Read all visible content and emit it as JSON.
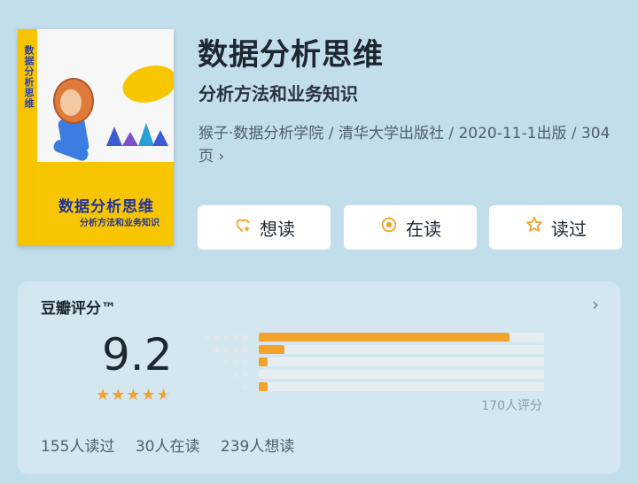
{
  "cover": {
    "spine_text": "数据分析思维",
    "title": "数据分析思维",
    "subtitle": "分析方法和业务知识"
  },
  "book": {
    "title": "数据分析思维",
    "subtitle": "分析方法和业务知识",
    "meta": "猴子·数据分析学院 / 清华大学出版社 / 2020-11-1出版 / 304页",
    "meta_chevron": "›"
  },
  "actions": {
    "want": {
      "label": "想读",
      "icon": "heart-plus-icon"
    },
    "reading": {
      "label": "在读",
      "icon": "target-icon"
    },
    "read": {
      "label": "读过",
      "icon": "star-icon"
    }
  },
  "rating": {
    "title": "豆瓣评分™",
    "score": "9.2",
    "stars_full": 4,
    "stars_partial": 0.6,
    "count": "170人评分",
    "distribution": [
      {
        "stars": 5,
        "fraction": 0.88
      },
      {
        "stars": 4,
        "fraction": 0.09
      },
      {
        "stars": 3,
        "fraction": 0.03
      },
      {
        "stars": 2,
        "fraction": 0.0
      },
      {
        "stars": 1,
        "fraction": 0.03
      }
    ],
    "accent": "#f3a22d"
  },
  "stats": {
    "read": "155人读过",
    "reading": "30人在读",
    "want": "239人想读"
  }
}
